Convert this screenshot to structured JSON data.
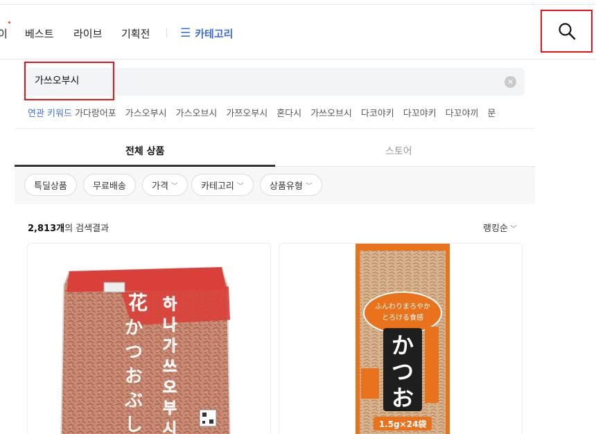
{
  "nav": {
    "cut_item": "이",
    "items": [
      {
        "label": "베스트"
      },
      {
        "label": "라이브"
      },
      {
        "label": "기획전"
      }
    ],
    "category_label": "카테고리",
    "category_icon": "menu-icon",
    "search_icon": "search-icon"
  },
  "search": {
    "query": "가쓰오부시",
    "clear_icon": "clear-icon"
  },
  "related": {
    "label": "연관 키워드",
    "keywords": [
      "가다랑어포",
      "가스오부시",
      "가스오브시",
      "가쯔오부시",
      "혼다시",
      "가쓰오브시",
      "다코야키",
      "다꼬야키",
      "다꼬야끼",
      "문"
    ]
  },
  "tabs": [
    {
      "label": "전체 상품",
      "active": true
    },
    {
      "label": "스토어",
      "active": false
    }
  ],
  "filters": [
    {
      "label": "특딜상품",
      "dropdown": false
    },
    {
      "label": "무료배송",
      "dropdown": false
    },
    {
      "label": "가격",
      "dropdown": true
    },
    {
      "label": "카테고리",
      "dropdown": true
    },
    {
      "label": "상품유형",
      "dropdown": true
    }
  ],
  "results": {
    "count": "2,813개",
    "suffix": "의 검색결과",
    "sort_label": "랭킹순"
  },
  "products": [
    {
      "image": "katsuobushi-large-bag",
      "bag_text_vertical": "하나가쓰오부시",
      "bag_text_jp": "花かつおぶし"
    },
    {
      "image": "katsuobushi-pack",
      "bag_text_jp": "かつお",
      "bag_badge": "ふんわりまろやか とろける食感",
      "bag_size": "1.5g×24袋"
    }
  ],
  "colors": {
    "accent_blue": "#3d6fdc",
    "highlight_red": "#e8131a"
  }
}
